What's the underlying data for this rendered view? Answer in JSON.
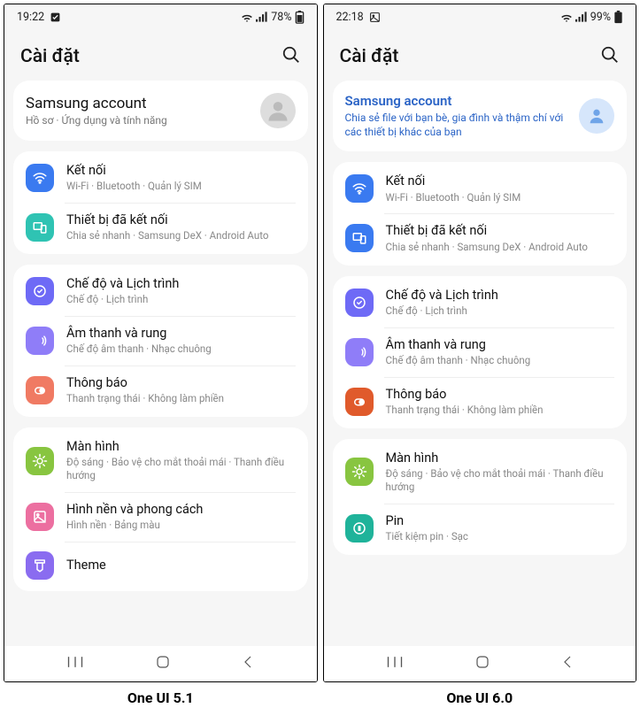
{
  "captions": {
    "left": "One UI 5.1",
    "right": "One UI 6.0"
  },
  "left": {
    "status": {
      "time": "19:22",
      "battery": "78%"
    },
    "header": {
      "title": "Cài đặt"
    },
    "account": {
      "title": "Samsung account",
      "sub": "Hồ sơ · Ứng dụng và tính năng"
    },
    "groups": [
      [
        {
          "icon": "wifi",
          "color": "#3a7af0",
          "title": "Kết nối",
          "sub": "Wi-Fi · Bluetooth · Quản lý SIM"
        },
        {
          "icon": "devices",
          "color": "#2fc3b3",
          "title": "Thiết bị đã kết nối",
          "sub": "Chia sẻ nhanh · Samsung DeX · Android Auto"
        }
      ],
      [
        {
          "icon": "modes",
          "color": "#6e6af6",
          "title": "Chế độ và Lịch trình",
          "sub": "Chế độ · Lịch trình"
        },
        {
          "icon": "sound",
          "color": "#8f7df8",
          "title": "Âm thanh và rung",
          "sub": "Chế độ âm thanh · Nhạc chuông"
        },
        {
          "icon": "notif",
          "color": "#f07a63",
          "title": "Thông báo",
          "sub": "Thanh trạng thái · Không làm phiền"
        }
      ],
      [
        {
          "icon": "display",
          "color": "#88c540",
          "title": "Màn hình",
          "sub": "Độ sáng · Bảo vệ cho mắt thoải mái · Thanh điều hướng"
        },
        {
          "icon": "wallpaper",
          "color": "#ec6fa0",
          "title": "Hình nền và phong cách",
          "sub": "Hình nền · Bảng màu"
        },
        {
          "icon": "theme",
          "color": "#8a6cf0",
          "title": "Theme",
          "sub": ""
        }
      ]
    ]
  },
  "right": {
    "status": {
      "time": "22:18",
      "battery": "99%"
    },
    "header": {
      "title": "Cài đặt"
    },
    "account": {
      "title": "Samsung account",
      "sub": "Chia sẻ file với bạn bè, gia đình và thậm chí với các thiết bị khác của bạn"
    },
    "groups": [
      [
        {
          "icon": "wifi",
          "color": "#3a7af0",
          "title": "Kết nối",
          "sub": "Wi-Fi · Bluetooth · Quản lý SIM"
        },
        {
          "icon": "devices",
          "color": "#3a7af0",
          "title": "Thiết bị đã kết nối",
          "sub": "Chia sẻ nhanh · Samsung DeX · Android Auto"
        }
      ],
      [
        {
          "icon": "modes",
          "color": "#6e6af6",
          "title": "Chế độ và Lịch trình",
          "sub": "Chế độ · Lịch trình"
        },
        {
          "icon": "sound",
          "color": "#8f7df8",
          "title": "Âm thanh và rung",
          "sub": "Chế độ âm thanh · Nhạc chuông"
        },
        {
          "icon": "notif",
          "color": "#e05a2b",
          "title": "Thông báo",
          "sub": "Thanh trạng thái · Không làm phiền"
        }
      ],
      [
        {
          "icon": "display",
          "color": "#88c540",
          "title": "Màn hình",
          "sub": "Độ sáng · Bảo vệ cho mắt thoải mái · Thanh điều hướng"
        },
        {
          "icon": "battery",
          "color": "#1fb39a",
          "title": "Pin",
          "sub": "Tiết kiệm pin · Sạc"
        }
      ]
    ]
  },
  "icons": {
    "wifi": "wifi-icon",
    "devices": "devices-icon",
    "modes": "modes-icon",
    "sound": "sound-icon",
    "notif": "notif-icon",
    "display": "display-icon",
    "wallpaper": "wallpaper-icon",
    "theme": "theme-icon",
    "battery": "battery-icon"
  }
}
